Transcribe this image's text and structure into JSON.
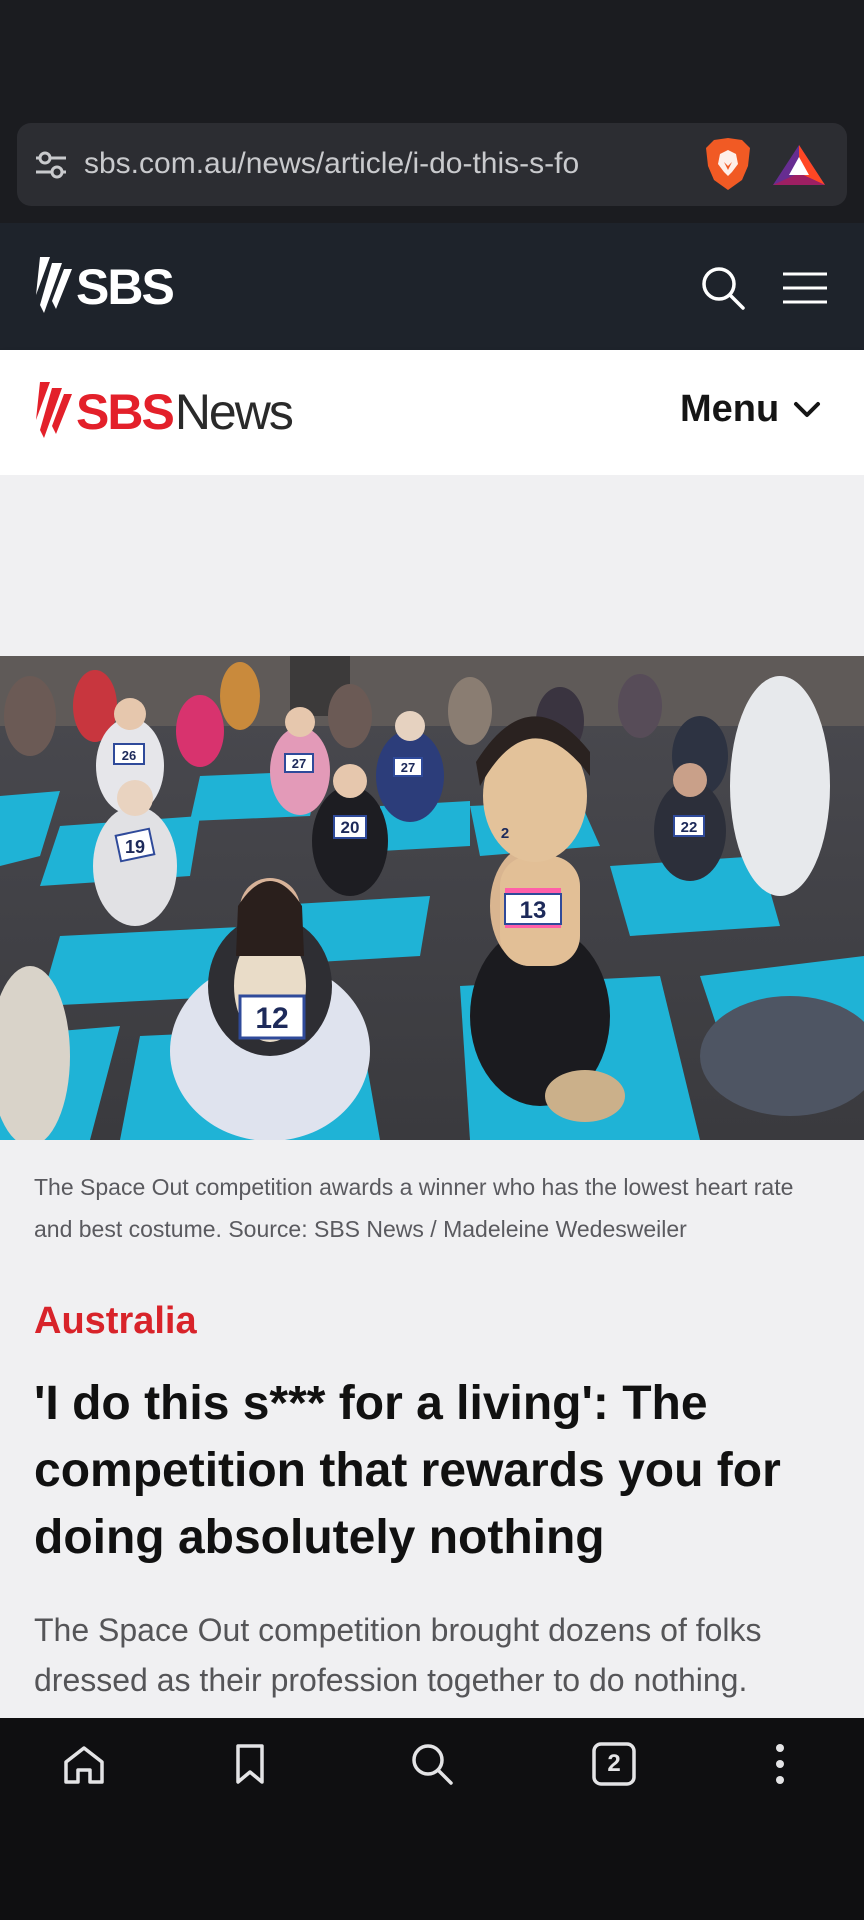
{
  "browser": {
    "url": "sbs.com.au/news/article/i-do-this-s-fo",
    "tab_count": "2"
  },
  "site": {
    "brand": "SBS",
    "news_brand_red": "SBS",
    "news_brand_dark": "News",
    "menu_label": "Menu"
  },
  "article": {
    "image_caption": "The Space Out competition awards a winner who has the lowest heart rate and best costume. Source: SBS News / Madeleine Wedesweiler",
    "category": "Australia",
    "headline": "'I do this s*** for a living': The competition that rewards you for doing absolutely nothing",
    "standfirst": "The Space Out competition brought dozens of folks dressed as their profession together to do nothing."
  },
  "hero_bibs": [
    "26",
    "27",
    "27",
    "19",
    "20",
    "12",
    "13",
    "22",
    "2"
  ],
  "colors": {
    "sbs_red": "#e3202a",
    "category_red": "#d8232a",
    "mat_cyan": "#1fb3d6",
    "dark_bar": "#1e232b"
  },
  "icons": [
    "tune-icon",
    "brave-lion-icon",
    "bat-triangle-icon",
    "search-icon",
    "hamburger-menu-icon",
    "chevron-down-icon",
    "home-icon",
    "bookmark-icon",
    "tabs-icon",
    "more-vertical-icon"
  ]
}
